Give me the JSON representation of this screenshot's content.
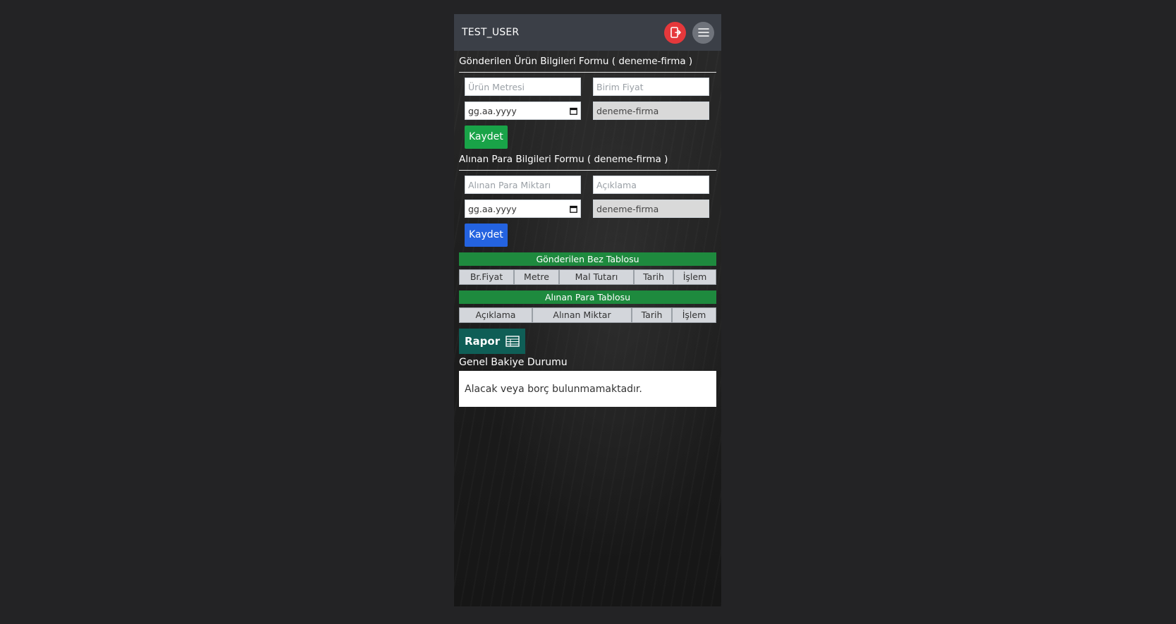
{
  "header": {
    "username": "TEST_USER",
    "logout_icon": "logout-icon",
    "menu_icon": "hamburger-menu-icon",
    "logout_color": "#e5383b"
  },
  "product_form": {
    "title": "Gönderilen Ürün Bilgileri Formu ( deneme-firma )",
    "meter_placeholder": "Ürün Metresi",
    "unit_price_placeholder": "Birim Fiyat",
    "date_placeholder": "gg.aa.yyyy",
    "company_value": "deneme-firma",
    "save_label": "Kaydet",
    "save_color": "#19a348"
  },
  "payment_form": {
    "title": "Alınan Para Bilgileri Formu ( deneme-firma )",
    "amount_placeholder": "Alınan Para Miktarı",
    "description_placeholder": "Açıklama",
    "date_placeholder": "gg.aa.yyyy",
    "company_value": "deneme-firma",
    "save_label": "Kaydet",
    "save_color": "#2463e0"
  },
  "sent_table": {
    "title": "Gönderilen Bez Tablosu",
    "columns": [
      "Br.Fiyat",
      "Metre",
      "Mal Tutarı",
      "Tarih",
      "İşlem"
    ]
  },
  "received_table": {
    "title": "Alınan Para Tablosu",
    "columns": [
      "Açıklama",
      "Alınan Miktar",
      "Tarih",
      "İşlem"
    ]
  },
  "report": {
    "label": "Rapor",
    "icon": "table-icon"
  },
  "balance": {
    "title": "Genel Bakiye Durumu",
    "message": "Alacak veya borç bulunmamaktadır."
  }
}
